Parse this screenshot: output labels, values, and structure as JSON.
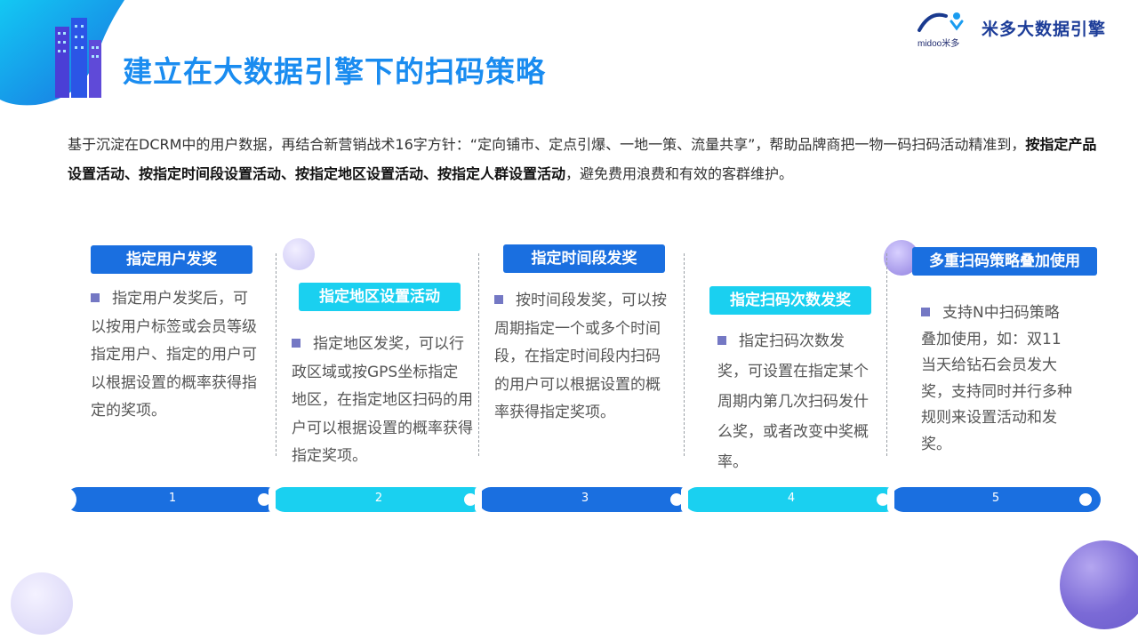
{
  "header": {
    "title": "建立在大数据引擎下的扫码策略",
    "logo_en": "midoo米多",
    "logo_cn": "米多大数据引擎"
  },
  "intro": {
    "text_1": "基于沉淀在DCRM中的用户数据，再结合新营销战术16字方针：“定向铺市、定点引爆、一地一策、流量共享”，帮助品牌商把一物一码扫码活动精准到，",
    "bold": "按指定产品设置活动、按指定时间段设置活动、按指定地区设置活动、按指定人群设置活动",
    "text_2": "，避免费用浪费和有效的客群维护。"
  },
  "steps": [
    {
      "number": "1",
      "label": "指定用户发奖",
      "desc": "指定用户发奖后，可以按用户标签或会员等级指定用户、指定的用户可以根据设置的概率获得指定的奖项。"
    },
    {
      "number": "2",
      "label": "指定地区设置活动",
      "desc": "指定地区发奖，可以行政区域或按GPS坐标指定地区，在指定地区扫码的用户可以根据设置的概率获得指定奖项。"
    },
    {
      "number": "3",
      "label": "指定时间段发奖",
      "desc": "按时间段发奖，可以按周期指定一个或多个时间段，在指定时间段内扫码的用户可以根据设置的概率获得指定奖项。"
    },
    {
      "number": "4",
      "label": "指定扫码次数发奖",
      "desc": "指定扫码次数发奖，可设置在指定某个周期内第几次扫码发什么奖，或者改变中奖概率。"
    },
    {
      "number": "5",
      "label": "多重扫码策略叠加使用",
      "desc": "支持N中扫码策略叠加使用，如：双11当天给钻石会员发大奖，支持同时并行多种规则来设置活动和发奖。"
    }
  ],
  "colors": {
    "blue": "#1a6fe0",
    "cyan": "#1ad0f0",
    "title": "#1a8cf0",
    "bullet": "#7478c4"
  }
}
